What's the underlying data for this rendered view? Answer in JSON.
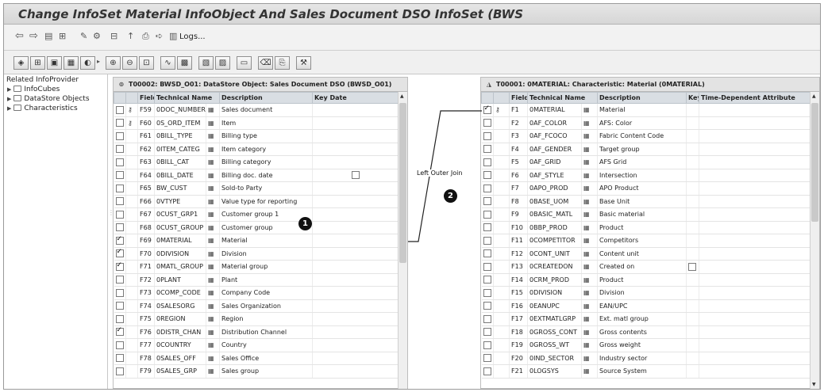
{
  "window": {
    "title": "Change InfoSet Material InfoObject And Sales Document DSO InfoSet (BWS"
  },
  "toolbar": {
    "logs_label": "Logs..."
  },
  "tree": {
    "header": "Related InfoProvider",
    "items": [
      {
        "label": "InfoCubes"
      },
      {
        "label": "DataStore Objects"
      },
      {
        "label": "Characteristics"
      }
    ]
  },
  "left_panel": {
    "title": "T00002: BWSD_O01: DataStore Object: Sales Document DSO (BWSD_O01)",
    "columns": [
      "Field",
      "Technical Name",
      "Description",
      "Key Date"
    ],
    "rows": [
      {
        "checked": false,
        "key": true,
        "field": "F59",
        "tech": "0DOC_NUMBER",
        "desc": "Sales document"
      },
      {
        "checked": false,
        "key": true,
        "field": "F60",
        "tech": "0S_ORD_ITEM",
        "desc": "Item"
      },
      {
        "checked": false,
        "key": false,
        "field": "F61",
        "tech": "0BILL_TYPE",
        "desc": "Billing type"
      },
      {
        "checked": false,
        "key": false,
        "field": "F62",
        "tech": "0ITEM_CATEG",
        "desc": "Item category"
      },
      {
        "checked": false,
        "key": false,
        "field": "F63",
        "tech": "0BILL_CAT",
        "desc": "Billing category"
      },
      {
        "checked": false,
        "key": false,
        "field": "F64",
        "tech": "0BILL_DATE",
        "desc": "Billing doc. date",
        "keydate": true
      },
      {
        "checked": false,
        "key": false,
        "field": "F65",
        "tech": "BW_CUST",
        "desc": "Sold-to Party"
      },
      {
        "checked": false,
        "key": false,
        "field": "F66",
        "tech": "0VTYPE",
        "desc": "Value type for reporting"
      },
      {
        "checked": false,
        "key": false,
        "field": "F67",
        "tech": "0CUST_GRP1",
        "desc": "Customer group 1"
      },
      {
        "checked": false,
        "key": false,
        "field": "F68",
        "tech": "0CUST_GROUP",
        "desc": "Customer group"
      },
      {
        "checked": true,
        "key": false,
        "field": "F69",
        "tech": "0MATERIAL",
        "desc": "Material"
      },
      {
        "checked": true,
        "key": false,
        "field": "F70",
        "tech": "0DIVISION",
        "desc": "Division"
      },
      {
        "checked": true,
        "key": false,
        "field": "F71",
        "tech": "0MATL_GROUP",
        "desc": "Material group"
      },
      {
        "checked": false,
        "key": false,
        "field": "F72",
        "tech": "0PLANT",
        "desc": "Plant"
      },
      {
        "checked": false,
        "key": false,
        "field": "F73",
        "tech": "0COMP_CODE",
        "desc": "Company Code"
      },
      {
        "checked": false,
        "key": false,
        "field": "F74",
        "tech": "0SALESORG",
        "desc": "Sales Organization"
      },
      {
        "checked": false,
        "key": false,
        "field": "F75",
        "tech": "0REGION",
        "desc": "Region"
      },
      {
        "checked": true,
        "key": false,
        "field": "F76",
        "tech": "0DISTR_CHAN",
        "desc": "Distribution Channel"
      },
      {
        "checked": false,
        "key": false,
        "field": "F77",
        "tech": "0COUNTRY",
        "desc": "Country"
      },
      {
        "checked": false,
        "key": false,
        "field": "F78",
        "tech": "0SALES_OFF",
        "desc": "Sales Office"
      },
      {
        "checked": false,
        "key": false,
        "field": "F79",
        "tech": "0SALES_GRP",
        "desc": "Sales group"
      }
    ]
  },
  "right_panel": {
    "title": "T00001: 0MATERIAL: Characteristic: Material (0MATERIAL)",
    "columns": [
      "Field",
      "Technical Name",
      "Description",
      "Key",
      "Time-Dependent Attribute"
    ],
    "rows": [
      {
        "checked": true,
        "key": true,
        "field": "F1",
        "tech": "0MATERIAL",
        "desc": "Material"
      },
      {
        "checked": false,
        "key": false,
        "field": "F2",
        "tech": "0AF_COLOR",
        "desc": "AFS: Color"
      },
      {
        "checked": false,
        "key": false,
        "field": "F3",
        "tech": "0AF_FCOCO",
        "desc": "Fabric Content Code"
      },
      {
        "checked": false,
        "key": false,
        "field": "F4",
        "tech": "0AF_GENDER",
        "desc": "Target group"
      },
      {
        "checked": false,
        "key": false,
        "field": "F5",
        "tech": "0AF_GRID",
        "desc": "AFS Grid"
      },
      {
        "checked": false,
        "key": false,
        "field": "F6",
        "tech": "0AF_STYLE",
        "desc": "Intersection"
      },
      {
        "checked": false,
        "key": false,
        "field": "F7",
        "tech": "0APO_PROD",
        "desc": "APO Product"
      },
      {
        "checked": false,
        "key": false,
        "field": "F8",
        "tech": "0BASE_UOM",
        "desc": "Base Unit"
      },
      {
        "checked": false,
        "key": false,
        "field": "F9",
        "tech": "0BASIC_MATL",
        "desc": "Basic material"
      },
      {
        "checked": false,
        "key": false,
        "field": "F10",
        "tech": "0BBP_PROD",
        "desc": "Product"
      },
      {
        "checked": false,
        "key": false,
        "field": "F11",
        "tech": "0COMPETITOR",
        "desc": "Competitors"
      },
      {
        "checked": false,
        "key": false,
        "field": "F12",
        "tech": "0CONT_UNIT",
        "desc": "Content unit"
      },
      {
        "checked": false,
        "key": false,
        "field": "F13",
        "tech": "0CREATEDON",
        "desc": "Created on",
        "keycol": true
      },
      {
        "checked": false,
        "key": false,
        "field": "F14",
        "tech": "0CRM_PROD",
        "desc": "Product"
      },
      {
        "checked": false,
        "key": false,
        "field": "F15",
        "tech": "0DIVISION",
        "desc": "Division"
      },
      {
        "checked": false,
        "key": false,
        "field": "F16",
        "tech": "0EANUPC",
        "desc": "EAN/UPC"
      },
      {
        "checked": false,
        "key": false,
        "field": "F17",
        "tech": "0EXTMATLGRP",
        "desc": "Ext. matl group"
      },
      {
        "checked": false,
        "key": false,
        "field": "F18",
        "tech": "0GROSS_CONT",
        "desc": "Gross contents"
      },
      {
        "checked": false,
        "key": false,
        "field": "F19",
        "tech": "0GROSS_WT",
        "desc": "Gross weight"
      },
      {
        "checked": false,
        "key": false,
        "field": "F20",
        "tech": "0IND_SECTOR",
        "desc": "Industry sector"
      },
      {
        "checked": false,
        "key": false,
        "field": "F21",
        "tech": "0LOGSYS",
        "desc": "Source System"
      }
    ]
  },
  "join": {
    "label": "Left Outer Join"
  },
  "badges": [
    "1",
    "2"
  ]
}
